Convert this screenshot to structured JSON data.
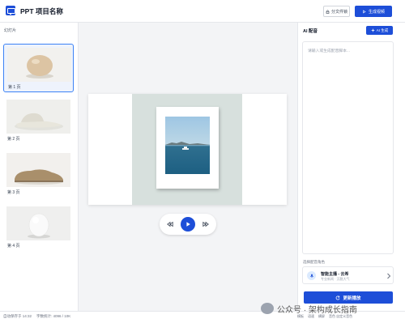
{
  "header": {
    "title": "PPT 项目名称",
    "outline_btn_label": "分文件锁",
    "primary_btn_label": "生成视频"
  },
  "sidebar": {
    "title": "幻灯片",
    "slides": [
      {
        "label": "第 1 页"
      },
      {
        "label": "第 2 页"
      },
      {
        "label": "第 3 页"
      },
      {
        "label": "第 4 页"
      }
    ]
  },
  "right": {
    "title": "AI 配音",
    "ai_btn_label": "AI 生成",
    "script_placeholder": "请输入或生成配音脚本...",
    "voice_section_label": "选择配音角色",
    "voice_name": "智能主播 - 云希",
    "voice_desc": "专业新闻 · 沉稳大气",
    "update_btn_label": "更新播放"
  },
  "footer": {
    "left_1": "自动保存于 14:32",
    "left_2": "字数统计: 4096 / 10K",
    "right_1": "模板",
    "right_2": "语速",
    "right_3": "横屏",
    "right_4": "音色 自定义音色"
  },
  "watermark": {
    "text": "公众号 · 架构成长指南"
  },
  "colors": {
    "accent": "#1d4ed8",
    "canvas_bg": "#f3f4f6",
    "active_slide_border": "#3b82f6"
  }
}
